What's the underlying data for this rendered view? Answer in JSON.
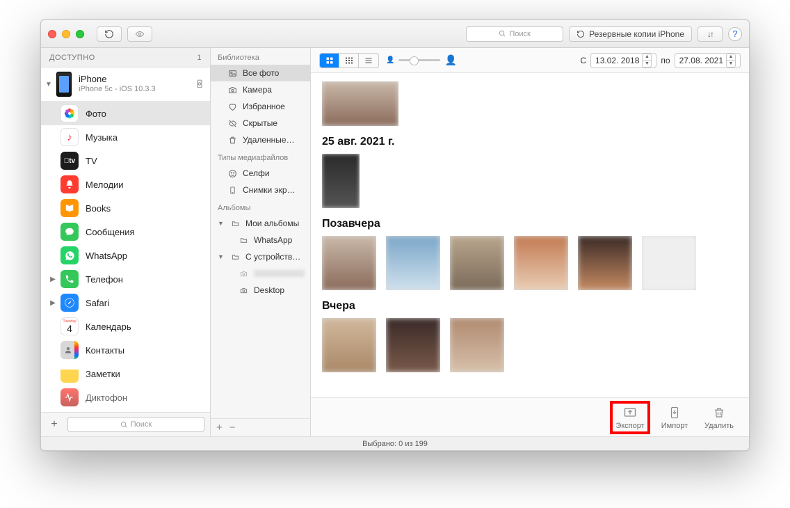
{
  "toolbar": {
    "search_placeholder": "Поиск",
    "backup_label": "Резервные копии iPhone"
  },
  "sidebar1": {
    "header": "ДОСТУПНО",
    "count": "1",
    "device": {
      "name": "iPhone",
      "sub": "iPhone 5c - iOS 10.3.3"
    },
    "items": [
      {
        "label": "Фото"
      },
      {
        "label": "Музыка"
      },
      {
        "label": "TV"
      },
      {
        "label": "Мелодии"
      },
      {
        "label": "Books"
      },
      {
        "label": "Сообщения"
      },
      {
        "label": "WhatsApp"
      },
      {
        "label": "Телефон"
      },
      {
        "label": "Safari"
      },
      {
        "label": "Календарь"
      },
      {
        "label": "Контакты"
      },
      {
        "label": "Заметки"
      },
      {
        "label": "Диктофон"
      }
    ],
    "calendar_hint": "Tuesday",
    "calendar_day": "4",
    "footer_search": "Поиск"
  },
  "sidebar2": {
    "sec_library": "Библиотека",
    "items_library": [
      {
        "label": "Все фото"
      },
      {
        "label": "Камера"
      },
      {
        "label": "Избранное"
      },
      {
        "label": "Скрытые"
      },
      {
        "label": "Удаленные…"
      }
    ],
    "sec_media": "Типы медиафайлов",
    "items_media": [
      {
        "label": "Селфи"
      },
      {
        "label": "Снимки экр…"
      }
    ],
    "sec_albums": "Альбомы",
    "my_albums": "Мои альбомы",
    "whatsapp": "WhatsApp",
    "from_device": "С устройств…",
    "hidden_album": "",
    "desktop": "Desktop"
  },
  "content_toolbar": {
    "from_label": "С",
    "from_date": "13.02. 2018",
    "to_label": "по",
    "to_date": "27.08. 2021"
  },
  "sections": [
    {
      "title": ""
    },
    {
      "title": "25 авг. 2021 г."
    },
    {
      "title": "Позавчера"
    },
    {
      "title": "Вчера"
    }
  ],
  "actions": {
    "export": "Экспорт",
    "import": "Импорт",
    "delete": "Удалить"
  },
  "status": "Выбрано: 0 из 199"
}
